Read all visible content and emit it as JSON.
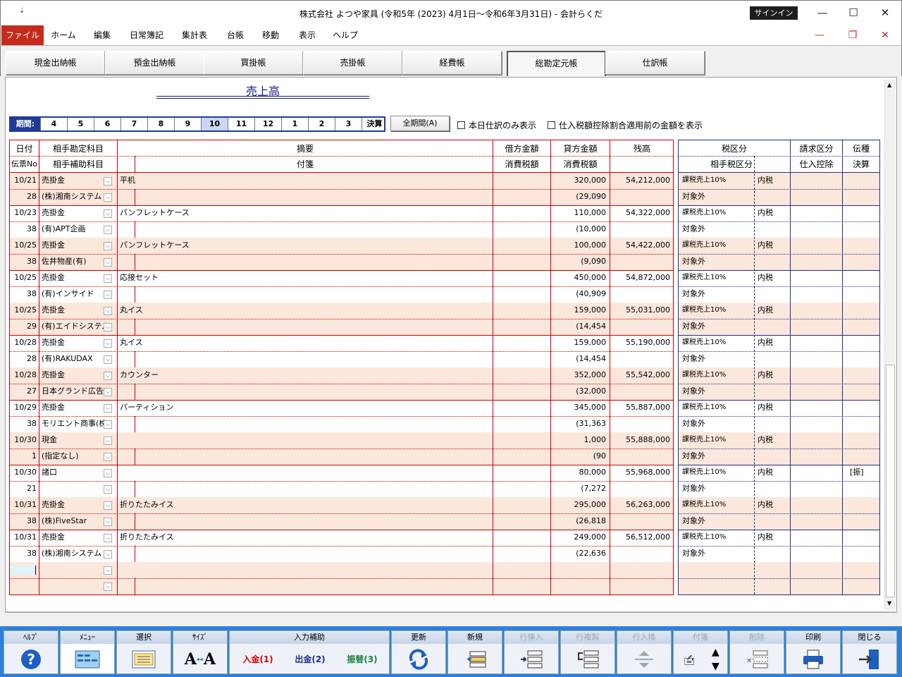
{
  "window": {
    "title": "株式会社 よつや家具 (令和5年 (2023) 4月1日～令和6年3月31日)  -  会計らくだ",
    "quick_access": "⇣",
    "signin": "サインイン",
    "min": "—",
    "max": "☐",
    "close": "✕"
  },
  "menu": {
    "items": [
      "ファイル",
      "ホーム",
      "編集",
      "日常簿記",
      "集計表",
      "台帳",
      "移動",
      "表示",
      "ヘルプ"
    ],
    "mdi_min": "—",
    "mdi_restore": "❐",
    "mdi_close": "✕"
  },
  "tabs": [
    "現金出納帳",
    "預金出納帳",
    "買掛帳",
    "売掛帳",
    "経費帳",
    "総勘定元帳",
    "仕訳帳"
  ],
  "ledger": {
    "title": "売上高"
  },
  "period": {
    "label": "期間:",
    "months": [
      "4",
      "5",
      "6",
      "7",
      "8",
      "9",
      "10",
      "11",
      "12",
      "1",
      "2",
      "3",
      "決算"
    ],
    "selected": "10",
    "all_button": "全期間(A)"
  },
  "options": {
    "today_only": "本日仕訳のみ表示",
    "tax_before": "仕入税額控除割合適用前の金額を表示"
  },
  "grid_headers": {
    "date": "日付",
    "voucher": "伝票No",
    "account": "相手勘定科目",
    "sub_account": "相手補助科目",
    "summary": "摘要",
    "memo": "付箋",
    "debit": "借方金額",
    "debit_tax": "消費税額",
    "credit": "貸方金額",
    "credit_tax": "消費税額",
    "balance": "残高",
    "tax_class": "税区分",
    "partner_tax": "相手税区分",
    "invoice": "請求区分",
    "purchase_deduct": "仕入控除",
    "voucher_type": "伝種",
    "settle": "決算"
  },
  "rows": [
    {
      "date": "10/21",
      "no": "28",
      "account": "売掛金",
      "sub": "(株)湘南システム",
      "summary": "平机",
      "credit": "320,000",
      "tax": "(29,090",
      "balance": "54,212,000",
      "tax_class": "課税売上10%",
      "tax_mode": "内税",
      "partner_tax": "対象外",
      "vtype": ""
    },
    {
      "date": "10/23",
      "no": "38",
      "account": "売掛金",
      "sub": "(有)APT企画",
      "summary": "パンフレットケース",
      "credit": "110,000",
      "tax": "(10,000",
      "balance": "54,322,000",
      "tax_class": "課税売上10%",
      "tax_mode": "内税",
      "partner_tax": "対象外",
      "vtype": ""
    },
    {
      "date": "10/25",
      "no": "38",
      "account": "売掛金",
      "sub": "佐井物産(有)",
      "summary": "パンフレットケース",
      "credit": "100,000",
      "tax": "(9,090",
      "balance": "54,422,000",
      "tax_class": "課税売上10%",
      "tax_mode": "内税",
      "partner_tax": "対象外",
      "vtype": ""
    },
    {
      "date": "10/25",
      "no": "38",
      "account": "売掛金",
      "sub": "(有)インサイド",
      "summary": "応接セット",
      "credit": "450,000",
      "tax": "(40,909",
      "balance": "54,872,000",
      "tax_class": "課税売上10%",
      "tax_mode": "内税",
      "partner_tax": "対象外",
      "vtype": ""
    },
    {
      "date": "10/25",
      "no": "29",
      "account": "売掛金",
      "sub": "(有)エイドシステム",
      "summary": "丸イス",
      "credit": "159,000",
      "tax": "(14,454",
      "balance": "55,031,000",
      "tax_class": "課税売上10%",
      "tax_mode": "内税",
      "partner_tax": "対象外",
      "vtype": ""
    },
    {
      "date": "10/28",
      "no": "28",
      "account": "売掛金",
      "sub": "(有)RAKUDAX",
      "summary": "丸イス",
      "credit": "159,000",
      "tax": "(14,454",
      "balance": "55,190,000",
      "tax_class": "課税売上10%",
      "tax_mode": "内税",
      "partner_tax": "対象外",
      "vtype": ""
    },
    {
      "date": "10/28",
      "no": "27",
      "account": "売掛金",
      "sub": "日本グランド広告",
      "summary": "カウンター",
      "credit": "352,000",
      "tax": "(32,000",
      "balance": "55,542,000",
      "tax_class": "課税売上10%",
      "tax_mode": "内税",
      "partner_tax": "対象外",
      "vtype": ""
    },
    {
      "date": "10/29",
      "no": "38",
      "account": "売掛金",
      "sub": "モリエント商事(株",
      "summary": "パーティション",
      "credit": "345,000",
      "tax": "(31,363",
      "balance": "55,887,000",
      "tax_class": "課税売上10%",
      "tax_mode": "内税",
      "partner_tax": "対象外",
      "vtype": ""
    },
    {
      "date": "10/30",
      "no": "1",
      "account": "現金",
      "sub": "(指定なし)",
      "summary": "",
      "credit": "1,000",
      "tax": "(90",
      "balance": "55,888,000",
      "tax_class": "課税売上10%",
      "tax_mode": "内税",
      "partner_tax": "対象外",
      "vtype": ""
    },
    {
      "date": "10/30",
      "no": "21",
      "account": "諸口",
      "sub": "",
      "summary": "",
      "credit": "80,000",
      "tax": "(7,272",
      "balance": "55,968,000",
      "tax_class": "課税売上10%",
      "tax_mode": "内税",
      "partner_tax": "対象外",
      "vtype": "[振]"
    },
    {
      "date": "10/31",
      "no": "38",
      "account": "売掛金",
      "sub": "(株)FiveStar",
      "summary": "折りたたみイス",
      "credit": "295,000",
      "tax": "(26,818",
      "balance": "56,263,000",
      "tax_class": "課税売上10%",
      "tax_mode": "内税",
      "partner_tax": "対象外",
      "vtype": ""
    },
    {
      "date": "10/31",
      "no": "38",
      "account": "売掛金",
      "sub": "(株)湘南システム",
      "summary": "折りたたみイス",
      "credit": "249,000",
      "tax": "(22,636",
      "balance": "56,512,000",
      "tax_class": "課税売上10%",
      "tax_mode": "内税",
      "partner_tax": "対象外",
      "vtype": ""
    }
  ],
  "dropdown_glyph": "⌵",
  "toolbar": {
    "help": "ﾍﾙﾌﾟ",
    "menu": "ﾒﾆｭｰ",
    "select": "選択",
    "size": "ｻｲｽﾞ",
    "input_assist": "入力補助",
    "nyukin": "入金(1)",
    "shukkin": "出金(2)",
    "furikae": "振替(3)",
    "update": "更新",
    "new": "新規",
    "row_insert": "行挿入",
    "row_copy": "行複製",
    "row_swap": "行入換",
    "memo": "付箋",
    "delete": "削除",
    "print": "印刷",
    "close": "閉じる"
  },
  "colors": {
    "accent_red": "#c42b1c",
    "toolbar_blue": "#2f7fd8",
    "row_alt": "#fce7dc",
    "grid_red": "#cc0000",
    "tax_blue": "#203080"
  }
}
